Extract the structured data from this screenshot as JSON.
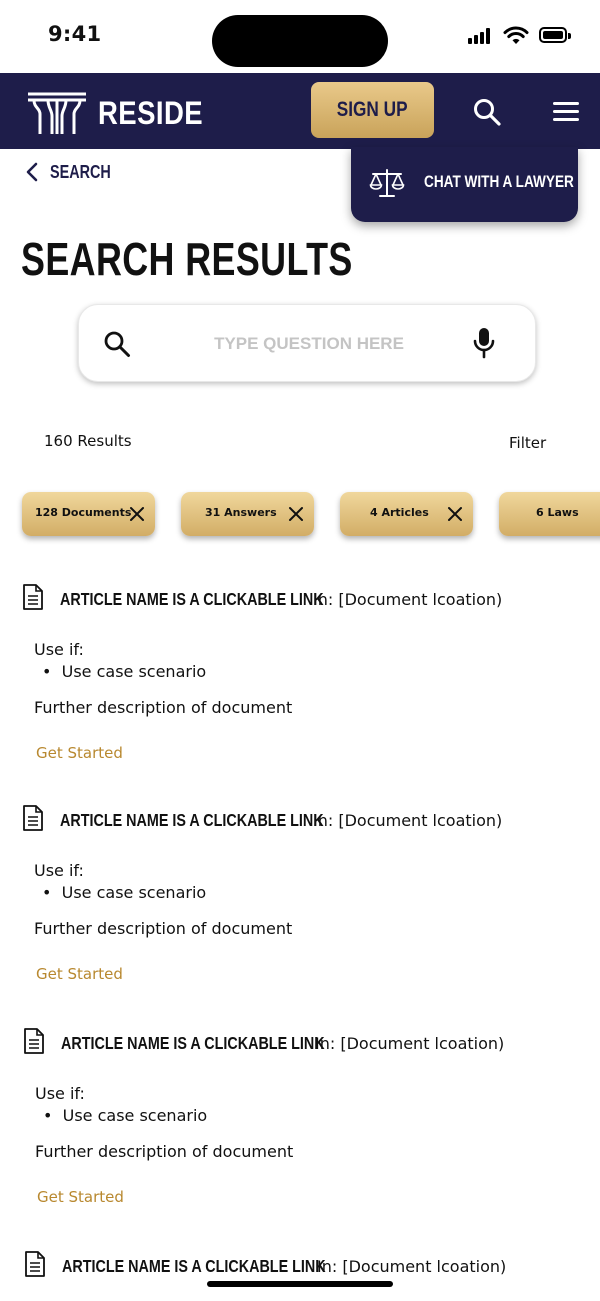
{
  "status_bar": {
    "time": "9:41"
  },
  "header": {
    "brand": "RESIDE",
    "signup_label": "SIGN UP",
    "colors": {
      "navy": "#1e1d4a",
      "gold": "#d2ad66"
    }
  },
  "nav": {
    "back_label": "SEARCH"
  },
  "chat": {
    "label": "CHAT WITH A LAWYER"
  },
  "page": {
    "title": "SEARCH RESULTS"
  },
  "search": {
    "placeholder": "TYPE QUESTION HERE"
  },
  "results_summary": {
    "count": "160 Results",
    "filter_label": "Filter"
  },
  "chips": [
    {
      "label": "128 Documents",
      "removable": true
    },
    {
      "label": "31 Answers",
      "removable": true
    },
    {
      "label": "4 Articles",
      "removable": true
    },
    {
      "label": "6 Laws",
      "removable": false
    }
  ],
  "results": [
    {
      "title": "ARTICLE NAME IS A CLICKABLE LINK",
      "location": "In: [Document lcoation)",
      "use_if": "Use if:",
      "bullet": "Use case scenario",
      "description": "Further description of document",
      "cta": "Get Started"
    },
    {
      "title": "ARTICLE NAME IS A CLICKABLE LINK",
      "location": "In: [Document lcoation)",
      "use_if": "Use if:",
      "bullet": "Use case scenario",
      "description": "Further description of document",
      "cta": "Get Started"
    },
    {
      "title": "ARTICLE NAME IS A CLICKABLE LINK",
      "location": "In: [Document lcoation)",
      "use_if": "Use if:",
      "bullet": "Use case scenario",
      "description": "Further description of document",
      "cta": "Get Started"
    },
    {
      "title": "ARTICLE NAME IS A CLICKABLE LINK",
      "location": "In: [Document lcoation)"
    }
  ]
}
